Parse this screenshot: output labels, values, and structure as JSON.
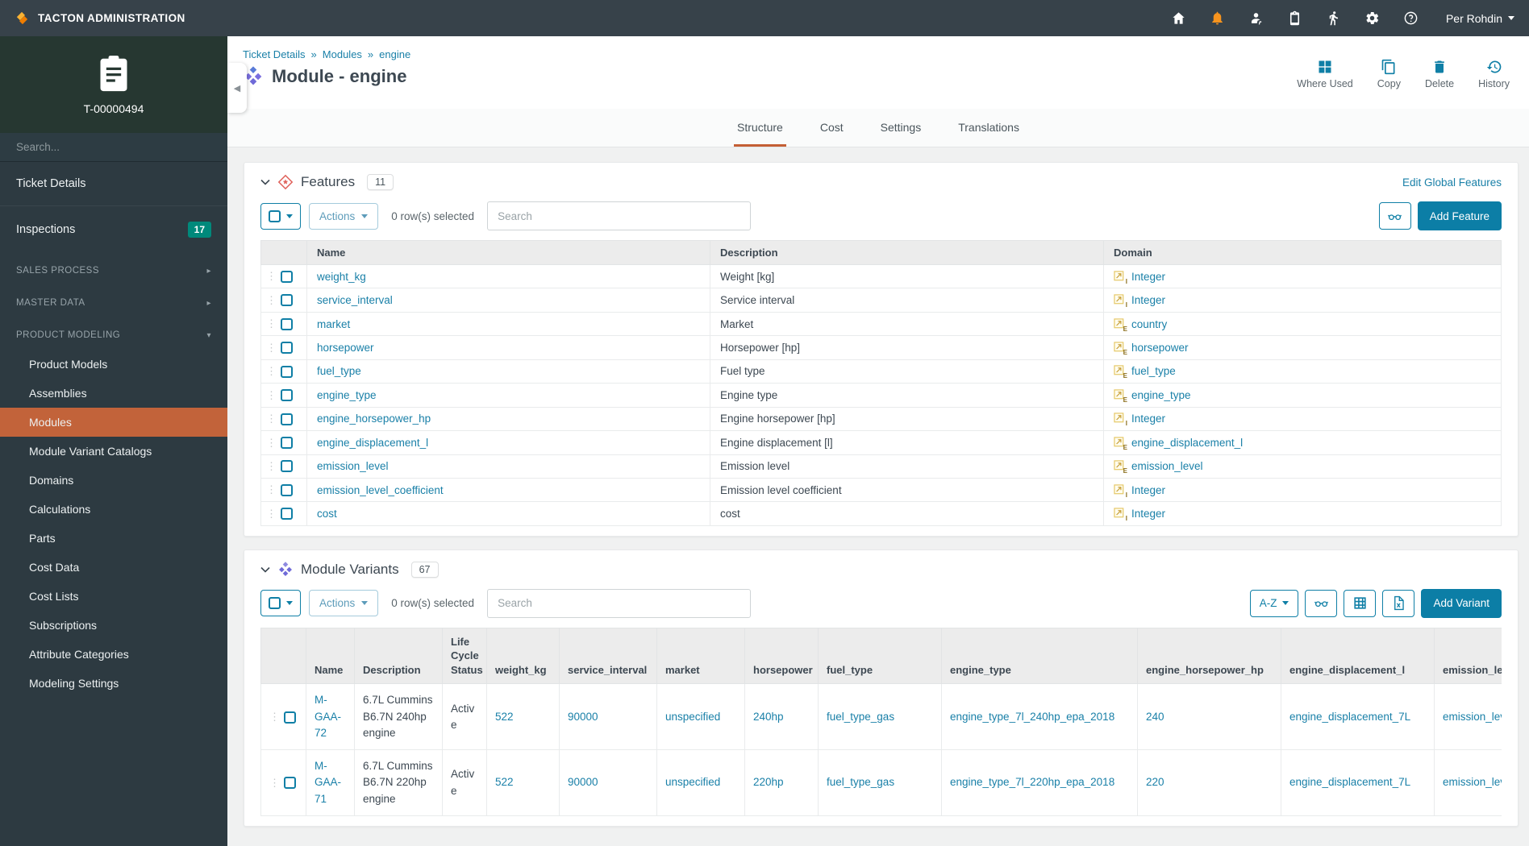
{
  "colors": {
    "accent_teal": "#0c7ea6",
    "accent_orange": "#c2633a",
    "badge_teal": "#00897b",
    "link_blue": "#1a80a8",
    "tab_underline": "#c45f35"
  },
  "topbar": {
    "brand": "TACTON ADMINISTRATION",
    "icons": [
      "home-icon",
      "notifications-bell-icon",
      "user-admin-icon",
      "tickets-clipboard-icon",
      "quick-actions-runner-icon",
      "settings-gear-icon",
      "help-icon"
    ],
    "user": "Per Rohdin"
  },
  "sidebar": {
    "ticket_id": "T-00000494",
    "search_placeholder": "Search...",
    "items": [
      {
        "label": "Ticket Details"
      },
      {
        "label": "Inspections",
        "badge": "17"
      },
      {
        "label": "SALES PROCESS"
      },
      {
        "label": "MASTER DATA"
      },
      {
        "label": "PRODUCT MODELING"
      },
      {
        "label": "Product Models"
      },
      {
        "label": "Assemblies"
      },
      {
        "label": "Modules"
      },
      {
        "label": "Module Variant Catalogs"
      },
      {
        "label": "Domains"
      },
      {
        "label": "Calculations"
      },
      {
        "label": "Parts"
      },
      {
        "label": "Cost Data"
      },
      {
        "label": "Cost Lists"
      },
      {
        "label": "Subscriptions"
      },
      {
        "label": "Attribute Categories"
      },
      {
        "label": "Modeling Settings"
      }
    ]
  },
  "breadcrumb": {
    "items": [
      "Ticket Details",
      "Modules",
      "engine"
    ],
    "separator": "»"
  },
  "header": {
    "title": "Module - engine",
    "actions": [
      {
        "label": "Where Used"
      },
      {
        "label": "Copy"
      },
      {
        "label": "Delete"
      },
      {
        "label": "History"
      }
    ]
  },
  "tabs": {
    "items": [
      {
        "label": "Structure"
      },
      {
        "label": "Cost"
      },
      {
        "label": "Settings"
      },
      {
        "label": "Translations"
      }
    ]
  },
  "features": {
    "title": "Features",
    "count": "11",
    "edit_link": "Edit Global Features",
    "actions_label": "Actions",
    "selected_text": "0 row(s) selected",
    "search_placeholder": "Search",
    "add_button": "Add Feature",
    "columns": [
      "Name",
      "Description",
      "Domain"
    ],
    "rows": [
      {
        "name": "weight_kg",
        "description": "Weight [kg]",
        "domain": "Integer",
        "dtype": "I"
      },
      {
        "name": "service_interval",
        "description": "Service interval",
        "domain": "Integer",
        "dtype": "I"
      },
      {
        "name": "market",
        "description": "Market",
        "domain": "country",
        "dtype": "E"
      },
      {
        "name": "horsepower",
        "description": "Horsepower [hp]",
        "domain": "horsepower",
        "dtype": "E"
      },
      {
        "name": "fuel_type",
        "description": "Fuel type",
        "domain": "fuel_type",
        "dtype": "E"
      },
      {
        "name": "engine_type",
        "description": "Engine type",
        "domain": "engine_type",
        "dtype": "E"
      },
      {
        "name": "engine_horsepower_hp",
        "description": "Engine horsepower [hp]",
        "domain": "Integer",
        "dtype": "I"
      },
      {
        "name": "engine_displacement_l",
        "description": "Engine displacement [l]",
        "domain": "engine_displacement_l",
        "dtype": "E"
      },
      {
        "name": "emission_level",
        "description": "Emission level",
        "domain": "emission_level",
        "dtype": "E"
      },
      {
        "name": "emission_level_coefficient",
        "description": "Emission level coefficient",
        "domain": "Integer",
        "dtype": "I"
      },
      {
        "name": "cost",
        "description": "cost",
        "domain": "Integer",
        "dtype": "I"
      }
    ]
  },
  "variants": {
    "title": "Module Variants",
    "count": "67",
    "actions_label": "Actions",
    "selected_text": "0 row(s) selected",
    "search_placeholder": "Search",
    "sort_label": "A-Z",
    "add_button": "Add Variant",
    "columns": [
      "Name",
      "Description",
      "Life Cycle Status",
      "weight_kg",
      "service_interval",
      "market",
      "horsepower",
      "fuel_type",
      "engine_type",
      "engine_horsepower_hp",
      "engine_displacement_l",
      "emission_level"
    ],
    "rows": [
      {
        "name": "M-GAA-72",
        "description": "6.7L Cummins B6.7N 240hp engine",
        "life_cycle_status": "Active",
        "weight_kg": "522",
        "service_interval": "90000",
        "market": "unspecified",
        "horsepower": "240hp",
        "fuel_type": "fuel_type_gas",
        "engine_type": "engine_type_7l_240hp_epa_2018",
        "engine_horsepower_hp": "240",
        "engine_displacement_l": "engine_displacement_7L",
        "emission_level": "emission_level_e"
      },
      {
        "name": "M-GAA-71",
        "description": "6.7L Cummins B6.7N 220hp engine",
        "life_cycle_status": "Active",
        "weight_kg": "522",
        "service_interval": "90000",
        "market": "unspecified",
        "horsepower": "220hp",
        "fuel_type": "fuel_type_gas",
        "engine_type": "engine_type_7l_220hp_epa_2018",
        "engine_horsepower_hp": "220",
        "engine_displacement_l": "engine_displacement_7L",
        "emission_level": "emission_level_e"
      }
    ]
  }
}
